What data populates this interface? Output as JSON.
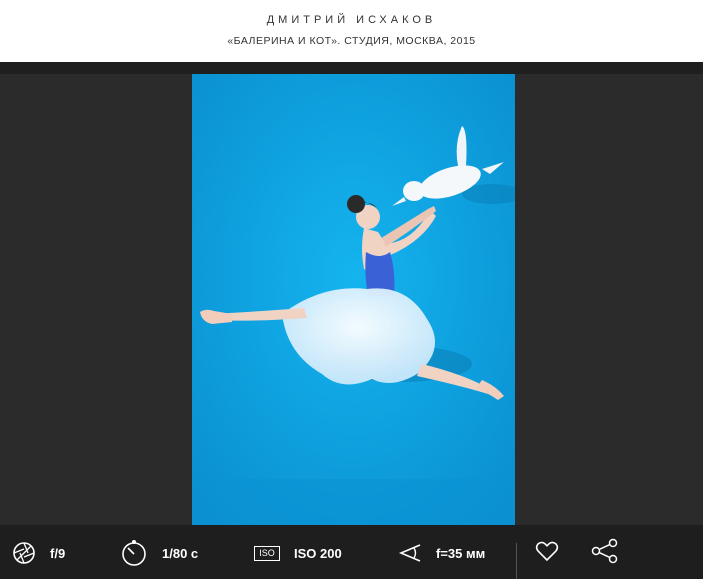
{
  "header": {
    "photographer": "ДМИТРИЙ ИСХАКОВ",
    "caption": "«БАЛЕРИНА И КОТ». СТУДИЯ, МОСКВА, 2015"
  },
  "photo": {
    "background_color": "#0aa0de"
  },
  "exif": {
    "aperture": "f/9",
    "shutter": "1/80 с",
    "iso_badge": "ISO",
    "iso": "ISO 200",
    "focal_length": "f=35 мм"
  },
  "actions": {
    "like_icon": "heart-icon",
    "share_icon": "share-icon"
  }
}
